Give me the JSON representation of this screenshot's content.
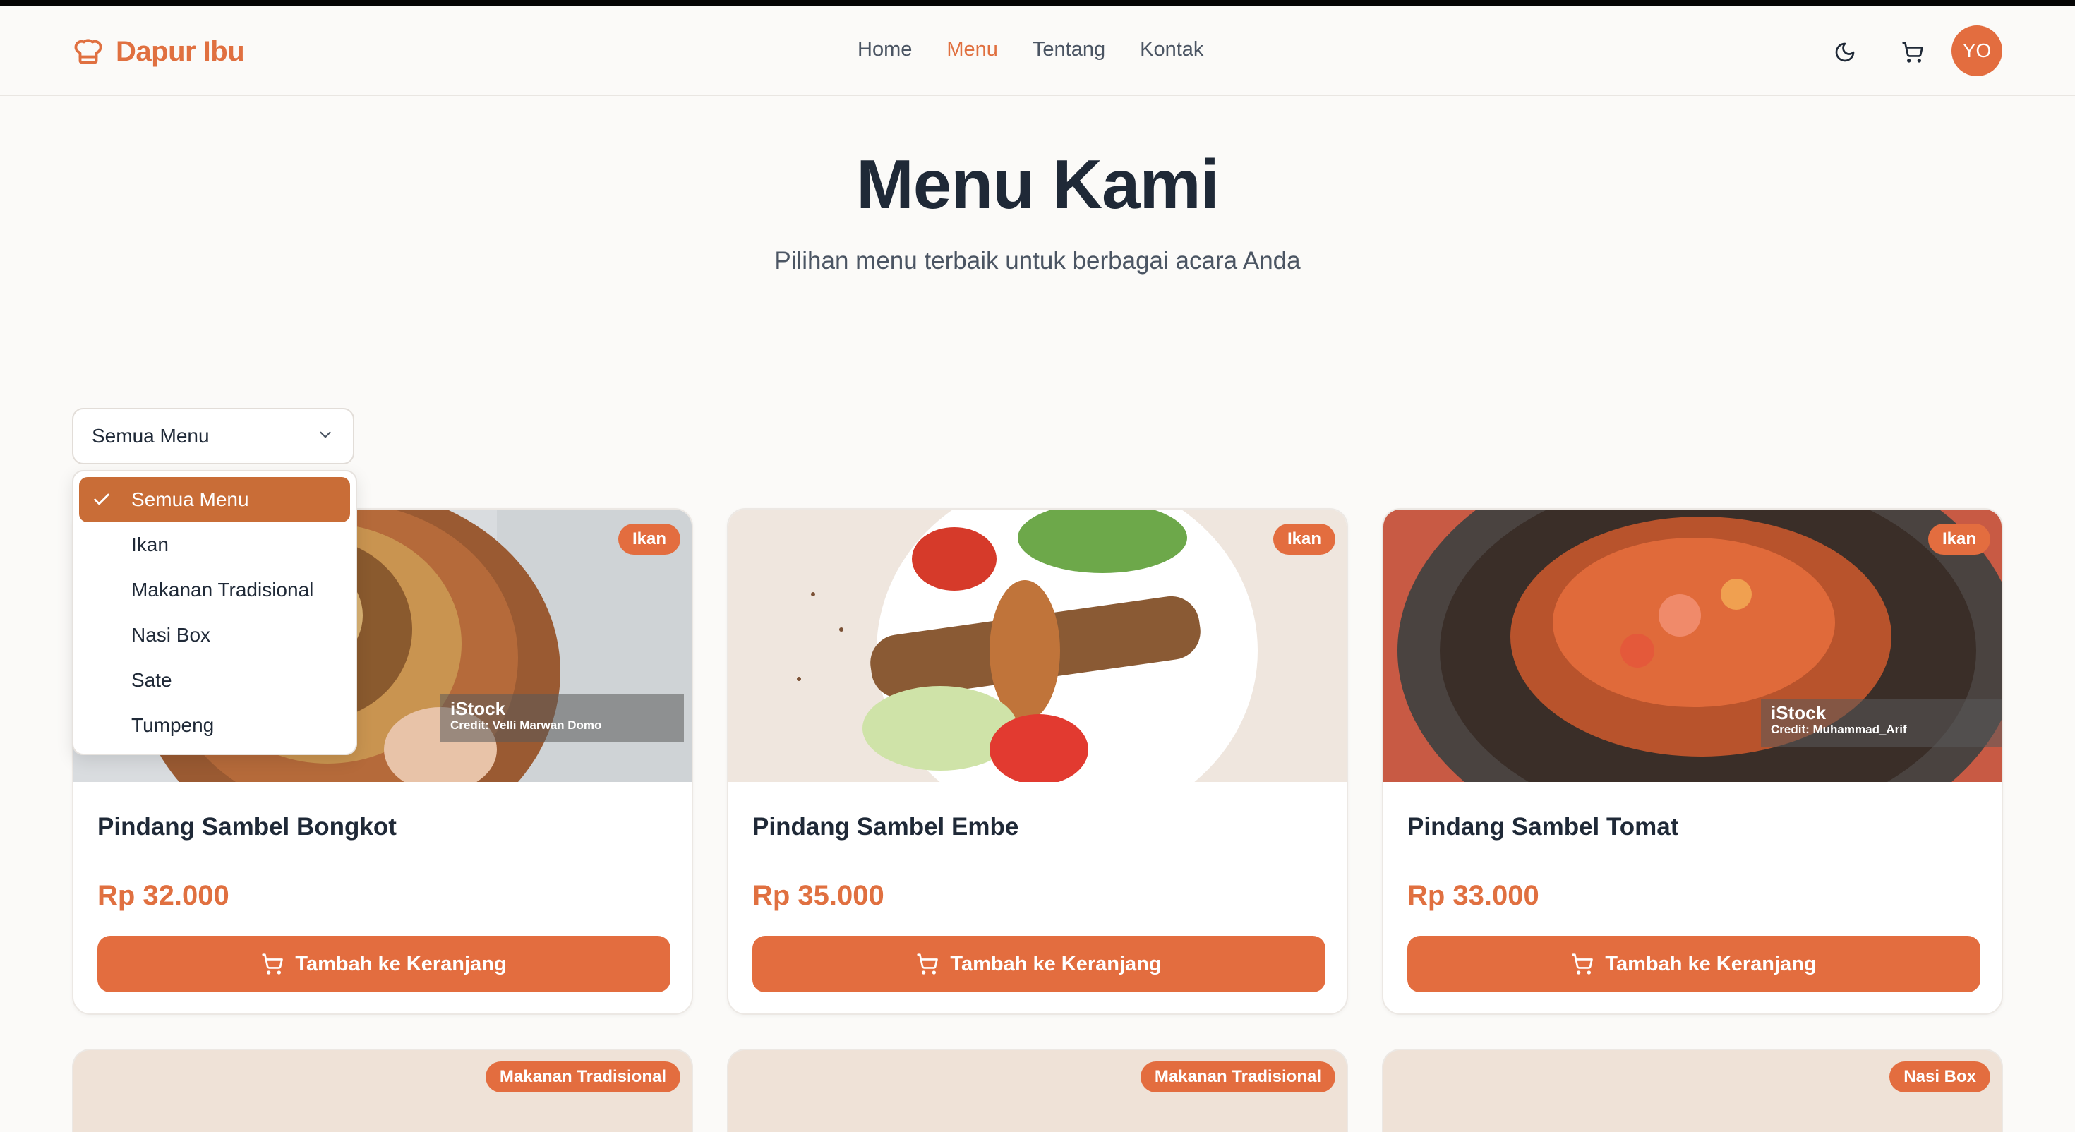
{
  "brand": {
    "name": "Dapur Ibu",
    "icon": "chef-hat-icon"
  },
  "nav": {
    "items": [
      {
        "label": "Home",
        "active": false
      },
      {
        "label": "Menu",
        "active": true
      },
      {
        "label": "Tentang",
        "active": false
      },
      {
        "label": "Kontak",
        "active": false
      }
    ]
  },
  "header_actions": {
    "theme_icon": "moon-icon",
    "cart_icon": "cart-icon",
    "avatar_initials": "YO"
  },
  "hero": {
    "title": "Menu Kami",
    "subtitle": "Pilihan menu terbaik untuk berbagai acara Anda"
  },
  "filter": {
    "selected": "Semua Menu",
    "options": [
      "Semua Menu",
      "Ikan",
      "Makanan Tradisional",
      "Nasi Box",
      "Sate",
      "Tumpeng"
    ]
  },
  "cards": [
    {
      "title": "Pindang Sambel Bongkot",
      "price": "Rp 32.000",
      "category": "Ikan",
      "button": "Tambah ke Keranjang",
      "watermark": {
        "brand": "iStock",
        "credit": "Credit: Velli Marwan Domo"
      }
    },
    {
      "title": "Pindang Sambel Embe",
      "price": "Rp 35.000",
      "category": "Ikan",
      "button": "Tambah ke Keranjang"
    },
    {
      "title": "Pindang Sambel Tomat",
      "price": "Rp 33.000",
      "category": "Ikan",
      "button": "Tambah ke Keranjang",
      "watermark": {
        "brand": "iStock",
        "credit": "Credit: Muhammad_Arif"
      }
    }
  ],
  "cards_row2": [
    {
      "category": "Makanan Tradisional"
    },
    {
      "category": "Makanan Tradisional"
    },
    {
      "category": "Nasi Box"
    }
  ],
  "colors": {
    "accent": "#e36d3f",
    "selected_option": "#c96d37",
    "background": "#fbfaf8"
  }
}
